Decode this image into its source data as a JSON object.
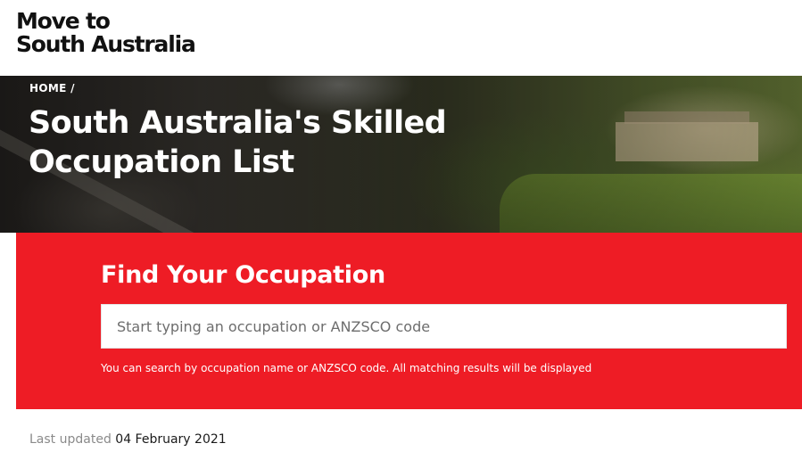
{
  "header": {
    "logo_line1": "Move to",
    "logo_line2": "South Australia"
  },
  "hero": {
    "breadcrumb_home": "HOME",
    "breadcrumb_sep": "/",
    "title": "South Australia's Skilled Occupation List"
  },
  "finder": {
    "title": "Find Your Occupation",
    "search_placeholder": "Start typing an occupation or ANZSCO code",
    "hint": "You can search by occupation name or ANZSCO code. All matching results will be displayed",
    "background_color": "#ee1c25"
  },
  "footer": {
    "updated_label": "Last updated",
    "updated_date": "04 February 2021"
  }
}
